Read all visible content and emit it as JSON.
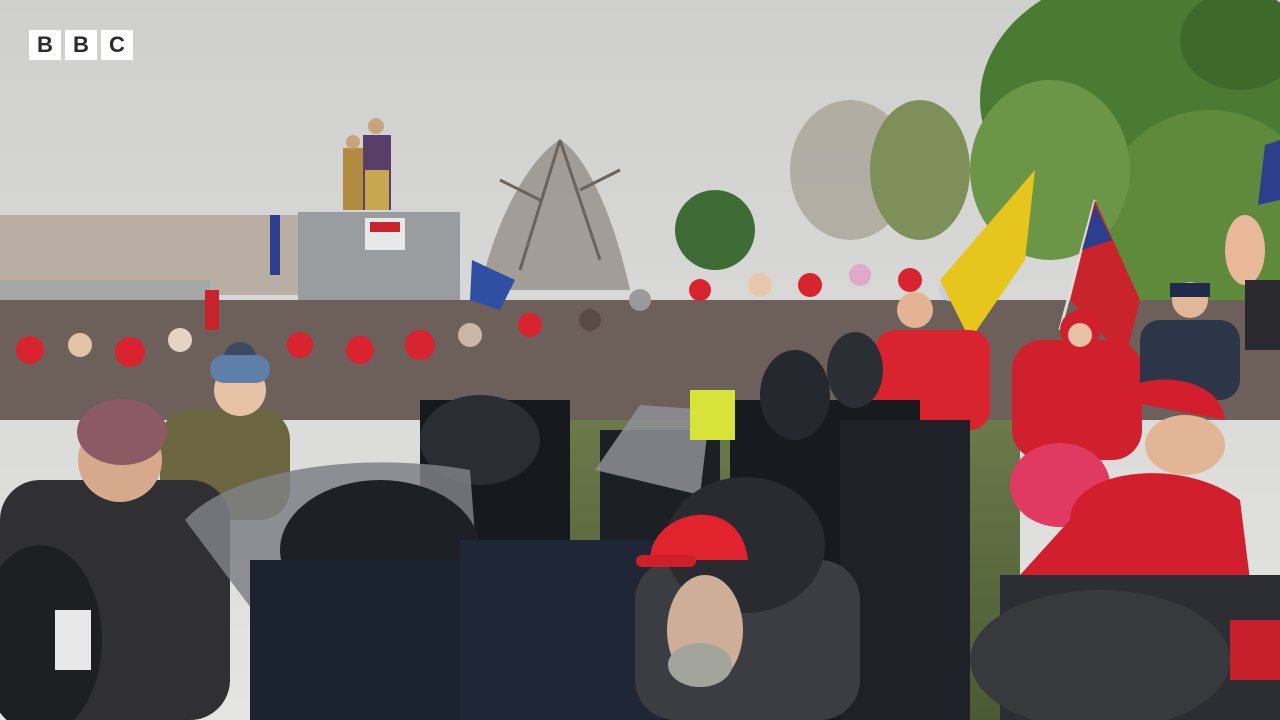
{
  "logo": {
    "letters": [
      "B",
      "B",
      "C"
    ]
  },
  "colors": {
    "sky": "#d9d9d7",
    "crowd_red": "#d9242f",
    "helmet_black": "#1c1f24",
    "tree_green": "#5f8a3c",
    "flag_yellow": "#e6c51c"
  }
}
